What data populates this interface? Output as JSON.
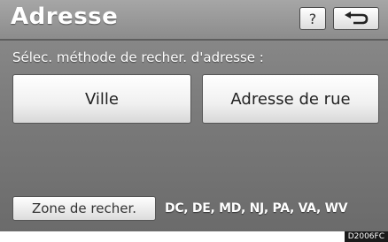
{
  "header": {
    "title": "Adresse",
    "help_label": "?",
    "back_icon": "return-arrow-icon"
  },
  "main": {
    "prompt": "Sélec. méthode de recher. d'adresse :",
    "buttons": [
      {
        "label": "Ville"
      },
      {
        "label": "Adresse de rue"
      }
    ]
  },
  "footer": {
    "zone_button_label": "Zone de recher.",
    "zone_value": "DC, DE, MD, NJ, PA, VA, WV"
  },
  "figure_code": "D2006FC"
}
